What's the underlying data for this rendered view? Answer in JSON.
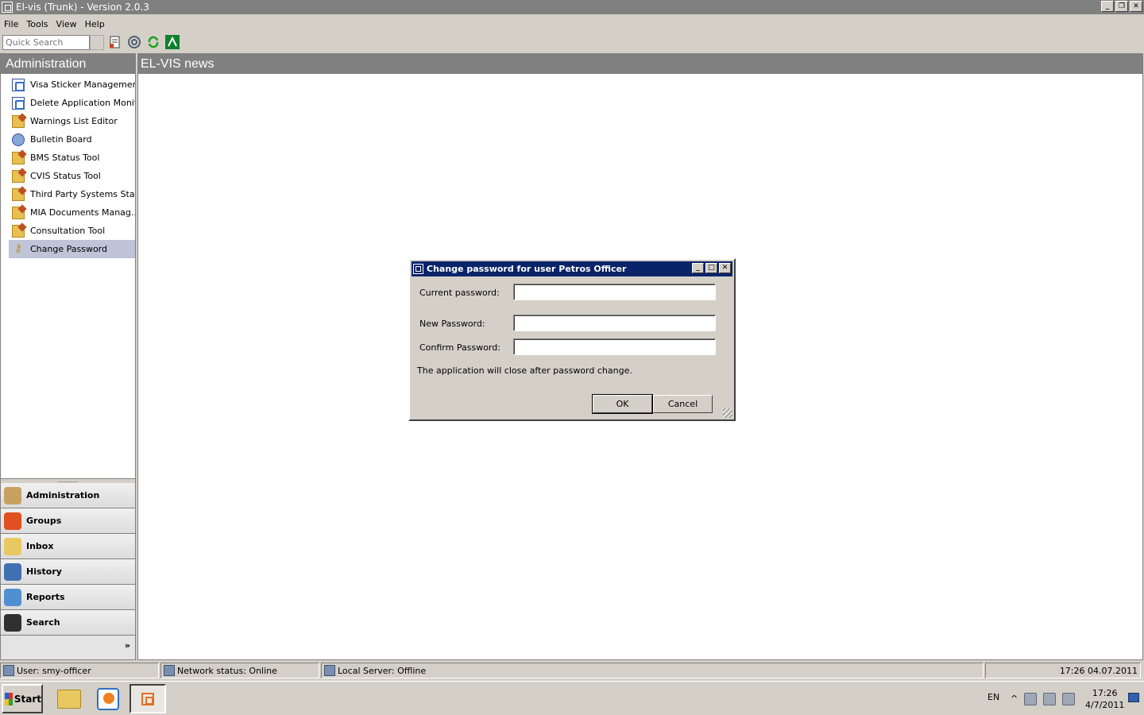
{
  "window": {
    "title": "El-vis (Trunk) - Version 2.0.3"
  },
  "menu": [
    "File",
    "Tools",
    "View",
    "Help"
  ],
  "toolbar": {
    "quick_search_placeholder": "Quick Search"
  },
  "left_panel": {
    "header": "Administration",
    "items": [
      {
        "label": "Visa Sticker Management",
        "icon": "blue-form-icon"
      },
      {
        "label": "Delete Application Monit...",
        "icon": "blue-form-icon"
      },
      {
        "label": "Warnings List Editor",
        "icon": "edit-icon"
      },
      {
        "label": "Bulletin Board",
        "icon": "globe-icon"
      },
      {
        "label": "BMS Status Tool",
        "icon": "edit-icon"
      },
      {
        "label": "CVIS Status Tool",
        "icon": "edit-icon"
      },
      {
        "label": "Third Party Systems Sta...",
        "icon": "edit-icon"
      },
      {
        "label": "MIA Documents Manag...",
        "icon": "edit-icon"
      },
      {
        "label": "Consultation Tool",
        "icon": "edit-icon"
      },
      {
        "label": "Change Password",
        "icon": "key-icon",
        "selected": true
      }
    ]
  },
  "bottom_nav": [
    {
      "label": "Administration",
      "icon": "admin-icon",
      "color": "#c8a060"
    },
    {
      "label": "Groups",
      "icon": "groups-icon",
      "color": "#e05020"
    },
    {
      "label": "Inbox",
      "icon": "inbox-icon",
      "color": "#e8c860"
    },
    {
      "label": "History",
      "icon": "history-icon",
      "color": "#4070b0"
    },
    {
      "label": "Reports",
      "icon": "reports-icon",
      "color": "#5090d0"
    },
    {
      "label": "Search",
      "icon": "binoculars-icon",
      "color": "#303030"
    }
  ],
  "main": {
    "header": "EL-VIS news"
  },
  "dialog": {
    "title": "Change password for user Petros Officer",
    "current_label": "Current password:",
    "new_label": "New Password:",
    "confirm_label": "Confirm Password:",
    "current_value": "",
    "new_value": "",
    "confirm_value": "",
    "note": "The application will close after password change.",
    "ok_label": "OK",
    "cancel_label": "Cancel"
  },
  "status": {
    "user": "User: smy-officer",
    "network": "Network status: Online",
    "server": "Local Server:  Offline",
    "datetime": "17:26 04.07.2011"
  },
  "taskbar": {
    "start": "Start",
    "lang": "EN",
    "time": "17:26",
    "date": "4/7/2011"
  }
}
